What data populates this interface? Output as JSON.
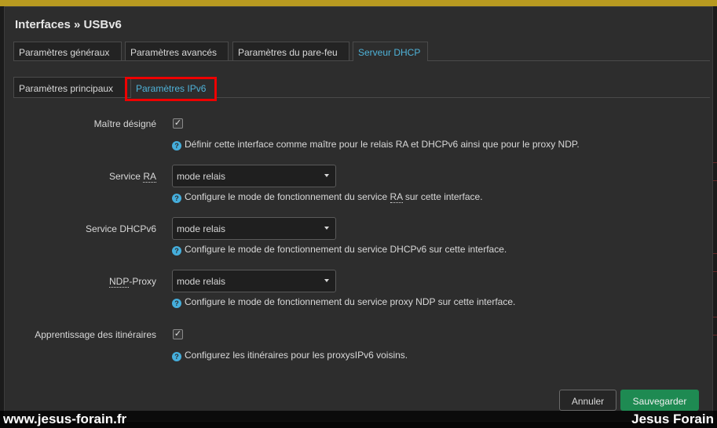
{
  "modal": {
    "title": "Interfaces » USBv6",
    "tabs": [
      "Paramètres généraux",
      "Paramètres avancés",
      "Paramètres du pare-feu",
      "Serveur DHCP"
    ],
    "active_tab": "Serveur DHCP",
    "subtabs": [
      "Paramètres principaux",
      "Paramètres IPv6"
    ],
    "active_subtab": "Paramètres IPv6"
  },
  "fields": {
    "master": {
      "label": "Maître désigné",
      "checked": true,
      "help": "Définir cette interface comme maître pour le relais RA et DHCPv6 ainsi que pour le proxy NDP."
    },
    "ra": {
      "label_prefix": "Service ",
      "label_abbr": "RA",
      "value": "mode relais",
      "help_pre": "Configure le mode de fonctionnement du service ",
      "help_abbr": "RA",
      "help_post": " sur cette interface."
    },
    "dhcpv6": {
      "label": "Service DHCPv6",
      "value": "mode relais",
      "help": "Configure le mode de fonctionnement du service DHCPv6 sur cette interface."
    },
    "ndp": {
      "label_abbr": "NDP",
      "label_suffix": "-Proxy",
      "value": "mode relais",
      "help": "Configure le mode de fonctionnement du service proxy NDP sur cette interface."
    },
    "learn_routes": {
      "label": "Apprentissage des itinéraires",
      "checked": true,
      "help": "Configurez les itinéraires pour les proxysIPv6 voisins."
    }
  },
  "buttons": {
    "cancel": "Annuler",
    "save": "Sauvegarder"
  },
  "icons": {
    "help": "question-icon",
    "check": "✓",
    "help_glyph": "?"
  },
  "watermark": {
    "left": "www.jesus-forain.fr",
    "right": "Jesus Forain"
  },
  "colors": {
    "accent": "#4fb3d9",
    "save": "#1e8a52",
    "highlight": "#ee0000"
  }
}
